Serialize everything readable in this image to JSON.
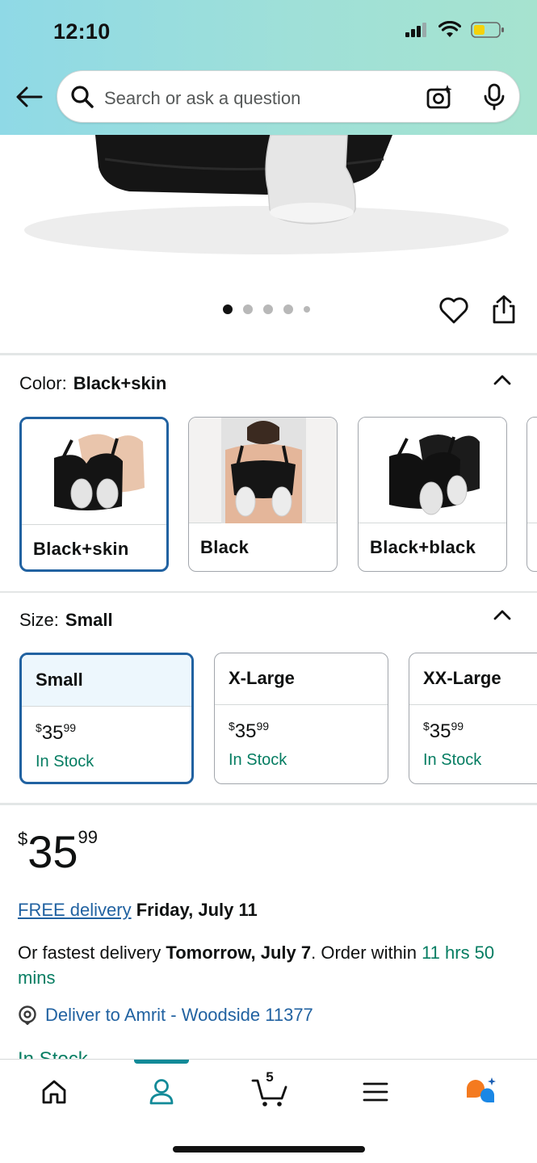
{
  "status_bar": {
    "time": "12:10"
  },
  "search": {
    "placeholder": "Search or ask a question"
  },
  "carousel": {
    "total_dots": 5,
    "active_index": 0
  },
  "color_section": {
    "label": "Color:",
    "selected": "Black+skin",
    "options": [
      {
        "label": "Black+skin"
      },
      {
        "label": "Black"
      },
      {
        "label": "Black+black"
      }
    ]
  },
  "size_section": {
    "label": "Size:",
    "selected": "Small",
    "options": [
      {
        "label": "Small",
        "price_symbol": "$",
        "price_whole": "35",
        "price_fraction": "99",
        "stock": "In Stock"
      },
      {
        "label": "X-Large",
        "price_symbol": "$",
        "price_whole": "35",
        "price_fraction": "99",
        "stock": "In Stock"
      },
      {
        "label": "XX-Large",
        "price_symbol": "$",
        "price_whole": "35",
        "price_fraction": "99",
        "stock": "In Stock"
      }
    ]
  },
  "price": {
    "symbol": "$",
    "whole": "35",
    "fraction": "99"
  },
  "delivery": {
    "free_link": "FREE delivery",
    "free_date": "Friday, July 11",
    "fast_prefix": "Or fastest delivery",
    "fast_date": "Tomorrow, July 7",
    "order_within": ". Order within",
    "time_left": "11 hrs 50 mins",
    "deliver_to": "Deliver to Amrit - Woodside 11377",
    "stock_status": "In Stock"
  },
  "bottom_nav": {
    "cart_count": "5"
  },
  "colors": {
    "header_gradient_start": "#8fd9e6",
    "header_gradient_end": "#a6e3cf",
    "link_blue": "#2162a1",
    "stock_green": "#067d62",
    "selected_border": "#2162a1",
    "nav_indicator": "#128a98"
  }
}
